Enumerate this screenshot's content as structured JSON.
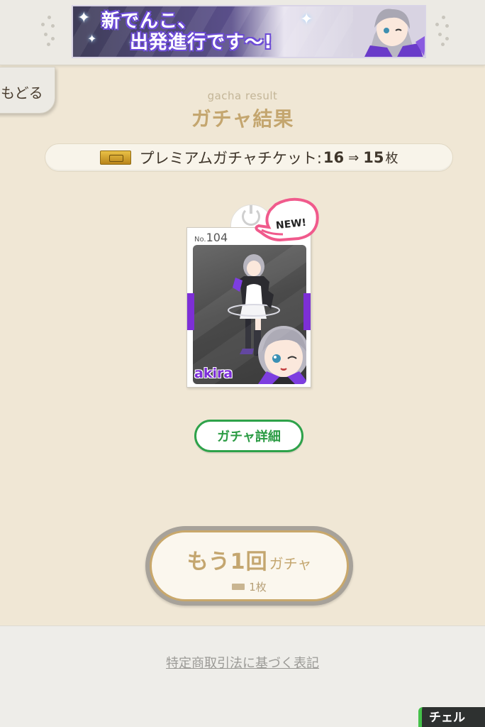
{
  "banner": {
    "line1": "新でんこ、",
    "line2": "出発進行です〜!"
  },
  "nav": {
    "back_label": "もどる"
  },
  "header": {
    "subtitle": "gacha result",
    "title": "ガチャ結果"
  },
  "ticket": {
    "label": "プレミアムガチャチケット:",
    "before": "16",
    "arrow": "⇒",
    "after": "15",
    "unit": "枚"
  },
  "card": {
    "no_prefix": "No.",
    "number": "104",
    "name": "akira",
    "badge": "NEW!",
    "accent_color": "#7d2fd6"
  },
  "buttons": {
    "detail_label": "ガチャ詳細",
    "again_main": "もう1回",
    "again_suffix": "ガチャ",
    "again_cost": "1枚"
  },
  "footer": {
    "legal_link": "特定商取引法に基づく表記",
    "chat_tab": "チェル"
  },
  "colors": {
    "background": "#f0e7d5",
    "gold_text": "#c4a66f",
    "green": "#2ea24a"
  }
}
